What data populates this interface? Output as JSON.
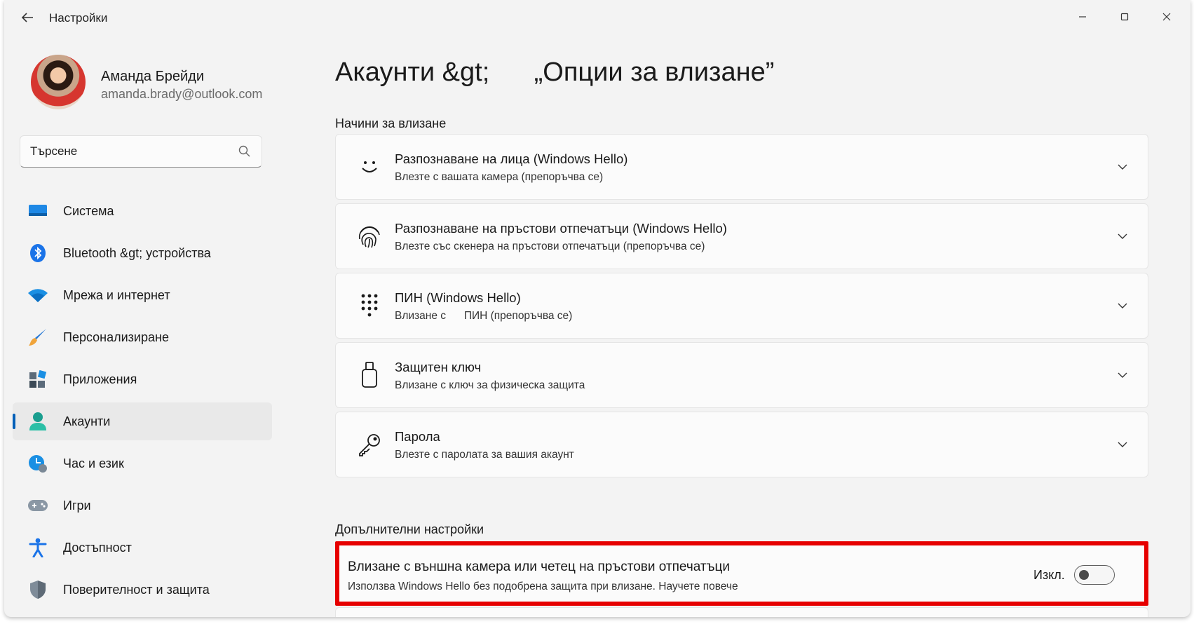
{
  "window": {
    "title": "Настройки"
  },
  "profile": {
    "name": "Аманда Брейди",
    "email": "amanda.brady@outlook.com"
  },
  "search": {
    "value": "Търсене"
  },
  "sidebar": {
    "items": [
      {
        "label": "Система",
        "icon": "system-icon",
        "selected": false
      },
      {
        "label": "Bluetooth &gt; устройства",
        "icon": "bluetooth-icon",
        "selected": false
      },
      {
        "label": "Мрежа и интернет",
        "icon": "wifi-icon",
        "selected": false
      },
      {
        "label": "Персонализиране",
        "icon": "paintbrush-icon",
        "selected": false
      },
      {
        "label": "Приложения",
        "icon": "apps-icon",
        "selected": false
      },
      {
        "label": "Акаунти",
        "icon": "accounts-icon",
        "selected": true
      },
      {
        "label": "Час и език",
        "icon": "time-language-icon",
        "selected": false
      },
      {
        "label": "Игри",
        "icon": "gamepad-icon",
        "selected": false
      },
      {
        "label": "Достъпност",
        "icon": "accessibility-icon",
        "selected": false
      },
      {
        "label": "Поверителност и защита",
        "icon": "shield-icon",
        "selected": false
      }
    ]
  },
  "main": {
    "title": "Акаунти &gt;      „Опции за влизане”",
    "sections": {
      "sign_in_ways": "Начини за влизане",
      "additional": "Допълнителни настройки"
    },
    "options": [
      {
        "title": "Разпознаване на лица (Windows Hello)",
        "desc": "Влезте с вашата камера (препоръчва се)",
        "icon": "face-icon"
      },
      {
        "title": "Разпознаване на пръстови отпечатъци (Windows Hello)",
        "desc": "Влезте със скенера на пръстови отпечатъци (препоръчва се)",
        "icon": "fingerprint-icon"
      },
      {
        "title": "ПИН (Windows Hello)",
        "desc": "Влизане с      ПИН (препоръчва се)",
        "icon": "pin-keypad-icon"
      },
      {
        "title": "Защитен ключ",
        "desc": "Влизане с ключ за физическа защита",
        "icon": "security-key-icon"
      },
      {
        "title": "Парола",
        "desc": "Влезте с паролата за вашия акаунт",
        "icon": "key-icon"
      }
    ],
    "external_camera": {
      "title": "Влизане с външна камера или четец на пръстови отпечатъци",
      "desc": "Използва Windows Hello без подобрена защита при влизане. Научете повече",
      "toggle_label": "Изкл.",
      "toggle_on": false
    }
  },
  "colors": {
    "accent": "#005fb8",
    "highlight_border": "#e60000",
    "background": "#f3f3f3"
  }
}
